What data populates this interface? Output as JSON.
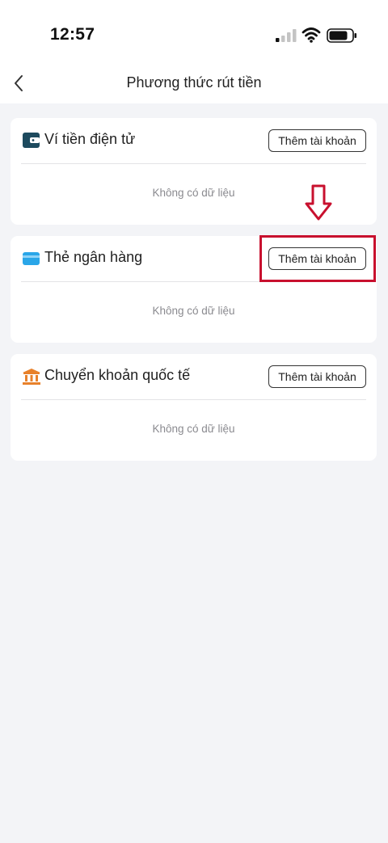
{
  "status_bar": {
    "time": "12:57",
    "signal_icon": "cellular-signal-icon",
    "wifi_icon": "wifi-icon",
    "battery_icon": "battery-icon"
  },
  "nav": {
    "title": "Phương thức rút tiền",
    "back_icon": "chevron-left-icon"
  },
  "cards": [
    {
      "title": "Ví tiền điện tử",
      "icon": "wallet-icon",
      "icon_color": "#1d4a5e",
      "button_label": "Thêm tài khoản",
      "empty_text": "Không có dữ liệu"
    },
    {
      "title": "Thẻ ngân hàng",
      "icon": "bank-card-icon",
      "icon_color": "#2aa6e8",
      "button_label": "Thêm tài khoản",
      "empty_text": "Không có dữ liệu"
    },
    {
      "title": "Chuyển khoản quốc tế",
      "icon": "bank-building-icon",
      "icon_color": "#e8812b",
      "button_label": "Thêm tài khoản",
      "empty_text": "Không có dữ liệu"
    }
  ],
  "annotation": {
    "color": "#c8102e",
    "arrow_icon": "down-arrow-icon"
  },
  "colors": {
    "background": "#f3f4f7",
    "card": "#ffffff",
    "muted_text": "#8a8a8f"
  }
}
